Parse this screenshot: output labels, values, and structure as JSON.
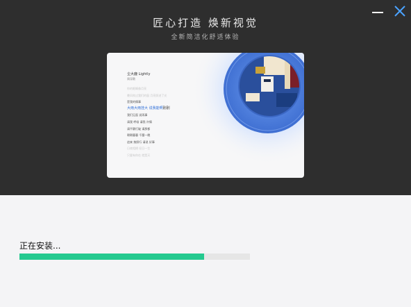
{
  "window": {
    "title": "匠心打造 焕新视觉",
    "subtitle": "全新简洁化舒适体验",
    "minimize_icon": "minimize-icon",
    "close_icon": "close-icon",
    "close_color": "#4aa3ff"
  },
  "preview": {
    "song_title": "尘大鹿 Lightly",
    "song_artist": "周深歌",
    "lyrics": [
      "你的眼睛像月亮",
      "晚风吹过我们的窗 月亮照进了光",
      "是我的情事",
      "大雨大雨挂大 说我能啊",
      "我们见面 说再事",
      "请我 呼吸 请我 许情",
      "请平静打破 请那都",
      "朝朝暮暮 千腰一晚",
      "追来 按照行 请说 好事",
      "日夜相拥 但日一生",
      "只要有你在 就是天"
    ],
    "active_lyric": "大雨大雨挂大 说我能啊",
    "active_lyric_tail": "别别",
    "disc_colors": {
      "glow": "#cfe0ff",
      "rim": "#3f6fd2",
      "inner": "#5a8ae6",
      "art": "#2a4f9c"
    }
  },
  "install": {
    "status_text": "正在安装...",
    "progress": 0.8,
    "progress_color": "#25c98f"
  }
}
